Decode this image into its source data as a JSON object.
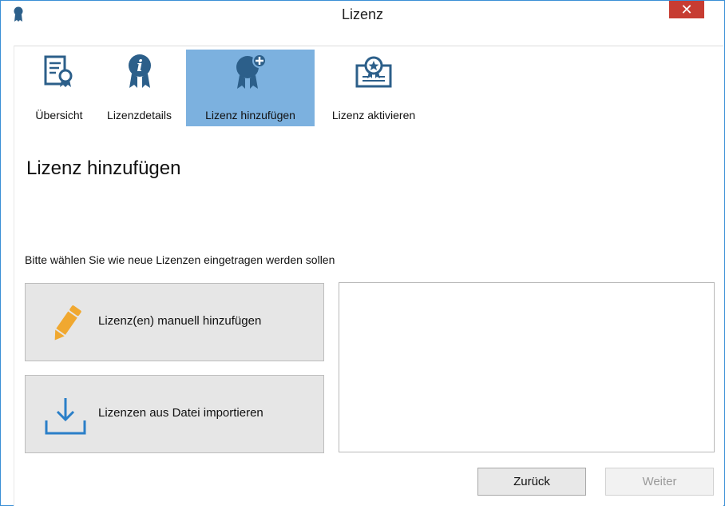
{
  "window": {
    "title": "Lizenz",
    "close_label": "✕"
  },
  "tabs": [
    {
      "label": "Übersicht",
      "icon": "certificate-document-icon",
      "active": false
    },
    {
      "label": "Lizenzdetails",
      "icon": "info-badge-icon",
      "active": false
    },
    {
      "label": "Lizenz hinzufügen",
      "icon": "add-badge-icon",
      "active": true
    },
    {
      "label": "Lizenz aktivieren",
      "icon": "certificate-star-icon",
      "active": false
    }
  ],
  "page": {
    "title": "Lizenz hinzufügen",
    "instruction": "Bitte wählen Sie wie neue Lizenzen eingetragen werden sollen"
  },
  "options": {
    "manual_label": "Lizenz(en) manuell hinzufügen",
    "manual_icon": "pencil-icon",
    "import_label": "Lizenzen aus Datei importieren",
    "import_icon": "download-tray-icon"
  },
  "footer": {
    "back_label": "Zurück",
    "next_label": "Weiter"
  },
  "colors": {
    "active_tab": "#7cb1df",
    "icon_blue": "#2c5f8a",
    "pencil_orange": "#f0a830",
    "close_red": "#c73c32"
  }
}
